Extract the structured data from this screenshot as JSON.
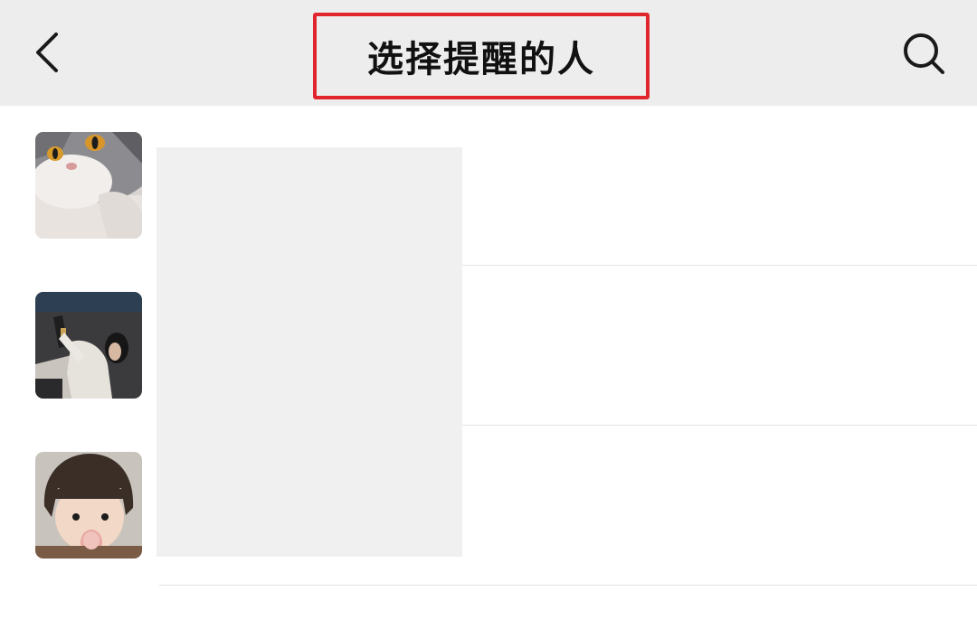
{
  "header": {
    "title": "选择提醒的人",
    "back_icon": "chevron-left-icon",
    "search_icon": "search-icon",
    "highlight_color": "#e0262c",
    "background": "#ededed"
  },
  "contacts": [
    {
      "avatar": "cat-photo-avatar",
      "name": ""
    },
    {
      "avatar": "person-with-bottle-avatar",
      "name": ""
    },
    {
      "avatar": "child-photo-avatar",
      "name": ""
    }
  ],
  "redaction_color": "#f0f0f0"
}
